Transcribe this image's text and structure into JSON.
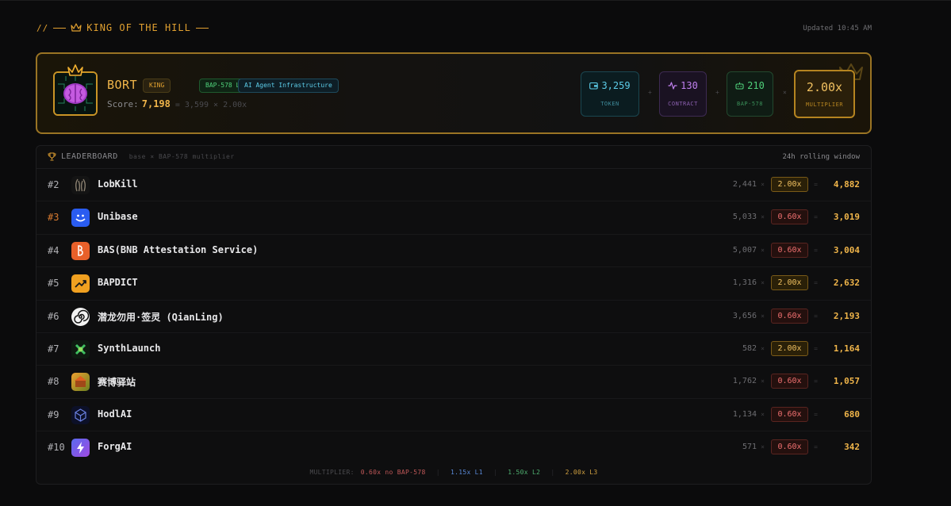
{
  "header": {
    "prefix": "//",
    "title": "KING OF THE HILL",
    "updated": "Updated 10:45 AM"
  },
  "king": {
    "name": "BORT",
    "badges": {
      "king": "KING",
      "bap": "BAP-578 L3",
      "category": "AI Agent Infrastructure"
    },
    "score_label": "Score:",
    "score": "7,198",
    "score_calc": "= 3,599 × 2.00x",
    "stats": {
      "token": {
        "value": "3,259",
        "label": "TOKEN",
        "icon": "wallet-icon"
      },
      "contract": {
        "value": "130",
        "label": "CONTRACT",
        "icon": "activity-icon"
      },
      "bap": {
        "value": "210",
        "label": "BAP-578",
        "icon": "robot-icon"
      },
      "multiplier": {
        "value": "2.00x",
        "label": "MULTIPLIER"
      }
    },
    "ops": {
      "plus1": "+",
      "plus2": "+",
      "times": "×"
    }
  },
  "leaderboard": {
    "title": "LEADERBOARD",
    "subtitle": "base × BAP-578 multiplier",
    "window": "24h rolling window",
    "rows": [
      {
        "rank": "#2",
        "name": "LobKill",
        "base": "2,441",
        "mult": "2.00x",
        "score": "4,882",
        "tier": "high"
      },
      {
        "rank": "#3",
        "name": "Unibase",
        "base": "5,033",
        "mult": "0.60x",
        "score": "3,019",
        "tier": "low"
      },
      {
        "rank": "#4",
        "name": "BAS(BNB Attestation Service)",
        "base": "5,007",
        "mult": "0.60x",
        "score": "3,004",
        "tier": "low"
      },
      {
        "rank": "#5",
        "name": "BAPDICT",
        "base": "1,316",
        "mult": "2.00x",
        "score": "2,632",
        "tier": "high"
      },
      {
        "rank": "#6",
        "name": "潜龙勿用·签灵 (QianLing)",
        "base": "3,656",
        "mult": "0.60x",
        "score": "2,193",
        "tier": "low"
      },
      {
        "rank": "#7",
        "name": "SynthLaunch",
        "base": "582",
        "mult": "2.00x",
        "score": "1,164",
        "tier": "high"
      },
      {
        "rank": "#8",
        "name": "赛博驿站",
        "base": "1,762",
        "mult": "0.60x",
        "score": "1,057",
        "tier": "low"
      },
      {
        "rank": "#9",
        "name": "HodlAI",
        "base": "1,134",
        "mult": "0.60x",
        "score": "680",
        "tier": "low"
      },
      {
        "rank": "#10",
        "name": "ForgAI",
        "base": "571",
        "mult": "0.60x",
        "score": "342",
        "tier": "low"
      }
    ],
    "ops": {
      "times": "×",
      "equals": "="
    },
    "legend": {
      "label": "MULTIPLIER:",
      "low": "0.60x no BAP-578",
      "l1": "1.15x L1",
      "l2": "1.50x L2",
      "l3": "2.00x L3",
      "sep": "|"
    }
  },
  "colors": {
    "accent": "#e0a030",
    "high_mult": "#f0c060",
    "low_mult": "#f07070",
    "token": "#5ccce8",
    "contract": "#c080f0",
    "bap": "#4fd07a"
  }
}
